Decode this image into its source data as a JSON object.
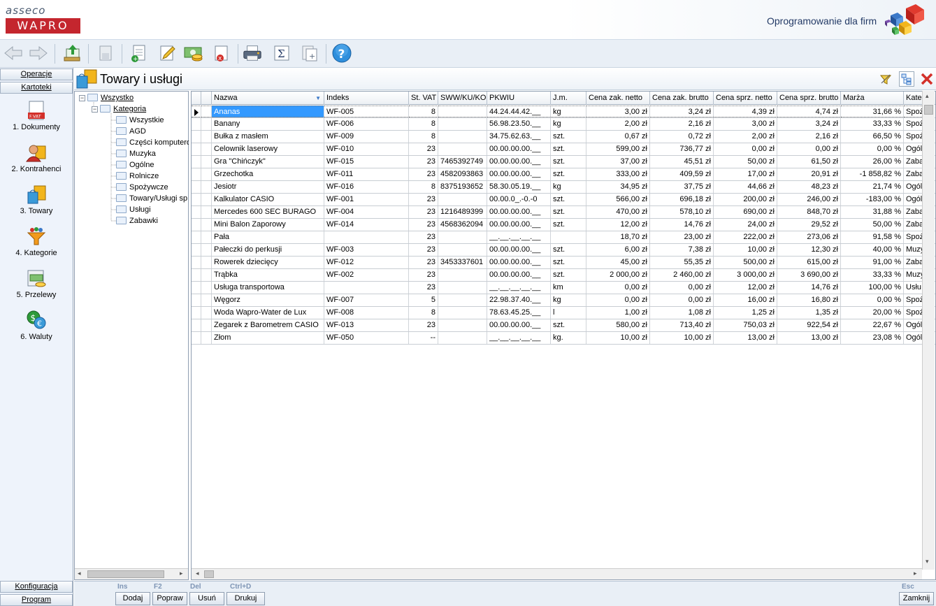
{
  "header": {
    "logo_top": "asseco",
    "logo_box": "WAPRO",
    "tagline": "Oprogramowanie dla firm"
  },
  "toolbar": {
    "icons": [
      "back-arrow-icon",
      "forward-arrow-icon",
      "export-icon",
      "import-icon",
      "add-document-icon",
      "edit-pencil-icon",
      "money-icon",
      "delete-icon",
      "printer-icon",
      "sum-icon",
      "document-add-icon",
      "help-icon"
    ]
  },
  "leftnav": {
    "top_buttons": [
      "Operacje",
      "Kartoteki"
    ],
    "items": [
      {
        "label": "1. Dokumenty",
        "icon": "invoice-icon",
        "badge": "F.VAT"
      },
      {
        "label": "2. Kontrahenci",
        "icon": "contractor-icon"
      },
      {
        "label": "3. Towary",
        "icon": "goods-icon"
      },
      {
        "label": "4. Kategorie",
        "icon": "categories-icon"
      },
      {
        "label": "5. Przelewy",
        "icon": "transfer-icon"
      },
      {
        "label": "6. Waluty",
        "icon": "currency-icon"
      }
    ],
    "bottom_buttons": [
      "Konfiguracja",
      "Program"
    ]
  },
  "window": {
    "title": "Towary i usługi"
  },
  "tree": {
    "root": "Wszystko",
    "category": "Kategoria",
    "children": [
      "Wszystkie",
      "AGD",
      "Części komputerowe",
      "Muzyka",
      "Ogólne",
      "Rolnicze",
      "Spożywcze",
      "Towary/Usługi sp",
      "Usługi",
      "Zabawki"
    ]
  },
  "grid": {
    "columns": [
      "Nazwa",
      "Indeks",
      "St. VAT",
      "SWW/KU/KO",
      "PKWIU",
      "J.m.",
      "Cena zak. netto",
      "Cena zak. brutto",
      "Cena sprz. netto",
      "Cena sprz. brutto",
      "Marża",
      "Kate"
    ],
    "rows": [
      [
        "Ananas",
        "WF-005",
        "8",
        "",
        "44.24.44.42.__",
        "kg",
        "3,00 zł",
        "3,24 zł",
        "4,39 zł",
        "4,74 zł",
        "31,66 %",
        "Spoż"
      ],
      [
        "Banany",
        "WF-006",
        "8",
        "",
        "56.98.23.50.__",
        "kg",
        "2,00 zł",
        "2,16 zł",
        "3,00 zł",
        "3,24 zł",
        "33,33 %",
        "Spoż"
      ],
      [
        "Bułka z masłem",
        "WF-009",
        "8",
        "",
        "34.75.62.63.__",
        "szt.",
        "0,67 zł",
        "0,72 zł",
        "2,00 zł",
        "2,16 zł",
        "66,50 %",
        "Spoż"
      ],
      [
        "Celownik laserowy",
        "WF-010",
        "23",
        "",
        "00.00.00.00.__",
        "szt.",
        "599,00 zł",
        "736,77 zł",
        "0,00 zł",
        "0,00 zł",
        "0,00 %",
        "Ogól"
      ],
      [
        "Gra \"Chińczyk\"",
        "WF-015",
        "23",
        "7465392749",
        "00.00.00.00.__",
        "szt.",
        "37,00 zł",
        "45,51 zł",
        "50,00 zł",
        "61,50 zł",
        "26,00 %",
        "Zaba"
      ],
      [
        "Grzechotka",
        "WF-011",
        "23",
        "4582093863",
        "00.00.00.00.__",
        "szt.",
        "333,00 zł",
        "409,59 zł",
        "17,00 zł",
        "20,91 zł",
        "-1 858,82 %",
        "Zaba"
      ],
      [
        "Jesiotr",
        "WF-016",
        "8",
        "8375193652",
        "58.30.05.19.__",
        "kg",
        "34,95 zł",
        "37,75 zł",
        "44,66 zł",
        "48,23 zł",
        "21,74 %",
        "Ogól"
      ],
      [
        "Kalkulator CASIO",
        "WF-001",
        "23",
        "",
        "00.00.0_.-0.-0",
        "szt.",
        "566,00 zł",
        "696,18 zł",
        "200,00 zł",
        "246,00 zł",
        "-183,00 %",
        "Ogól"
      ],
      [
        "Mercedes 600 SEC BURAGO",
        "WF-004",
        "23",
        "1216489399",
        "00.00.00.00.__",
        "szt.",
        "470,00 zł",
        "578,10 zł",
        "690,00 zł",
        "848,70 zł",
        "31,88 %",
        "Zaba"
      ],
      [
        "Mini Balon Zaporowy",
        "WF-014",
        "23",
        "4568362094",
        "00.00.00.00.__",
        "szt.",
        "12,00 zł",
        "14,76 zł",
        "24,00 zł",
        "29,52 zł",
        "50,00 %",
        "Zaba"
      ],
      [
        "Pała",
        "",
        "23",
        "",
        "__.__.__.__.__",
        "",
        "18,70 zł",
        "23,00 zł",
        "222,00 zł",
        "273,06 zł",
        "91,58 %",
        "Spoż"
      ],
      [
        "Pałeczki do perkusji",
        "WF-003",
        "23",
        "",
        "00.00.00.00.__",
        "szt.",
        "6,00 zł",
        "7,38 zł",
        "10,00 zł",
        "12,30 zł",
        "40,00 %",
        "Muzy"
      ],
      [
        "Rowerek dziecięcy",
        "WF-012",
        "23",
        "3453337601",
        "00.00.00.00.__",
        "szt.",
        "45,00 zł",
        "55,35 zł",
        "500,00 zł",
        "615,00 zł",
        "91,00 %",
        "Zaba"
      ],
      [
        "Trąbka",
        "WF-002",
        "23",
        "",
        "00.00.00.00.__",
        "szt.",
        "2 000,00 zł",
        "2 460,00 zł",
        "3 000,00 zł",
        "3 690,00 zł",
        "33,33 %",
        "Muzy"
      ],
      [
        "Usługa transportowa",
        "",
        "23",
        "",
        "__.__.__.__.__",
        "km",
        "0,00 zł",
        "0,00 zł",
        "12,00 zł",
        "14,76 zł",
        "100,00 %",
        "Usłu"
      ],
      [
        "Węgorz",
        "WF-007",
        "5",
        "",
        "22.98.37.40.__",
        "kg",
        "0,00 zł",
        "0,00 zł",
        "16,00 zł",
        "16,80 zł",
        "0,00 %",
        "Spoż"
      ],
      [
        "Woda Wapro-Water de Lux",
        "WF-008",
        "8",
        "",
        "78.63.45.25.__",
        "l",
        "1,00 zł",
        "1,08 zł",
        "1,25 zł",
        "1,35 zł",
        "20,00 %",
        "Spoż"
      ],
      [
        "Zegarek z Barometrem CASIO",
        "WF-013",
        "23",
        "",
        "00.00.00.00.__",
        "szt.",
        "580,00 zł",
        "713,40 zł",
        "750,03 zł",
        "922,54 zł",
        "22,67 %",
        "Ogól"
      ],
      [
        "Złom",
        "WF-050",
        "--",
        "",
        "__.__.__.__.__",
        "kg.",
        "10,00 zł",
        "10,00 zł",
        "13,00 zł",
        "13,00 zł",
        "23,08 %",
        "Ogól"
      ]
    ]
  },
  "bottom": {
    "keys": [
      "Ins",
      "F2",
      "Del",
      "Ctrl+D",
      "Esc"
    ],
    "buttons": [
      "Dodaj",
      "Popraw",
      "Usuń",
      "Drukuj",
      "Zamknij"
    ]
  }
}
